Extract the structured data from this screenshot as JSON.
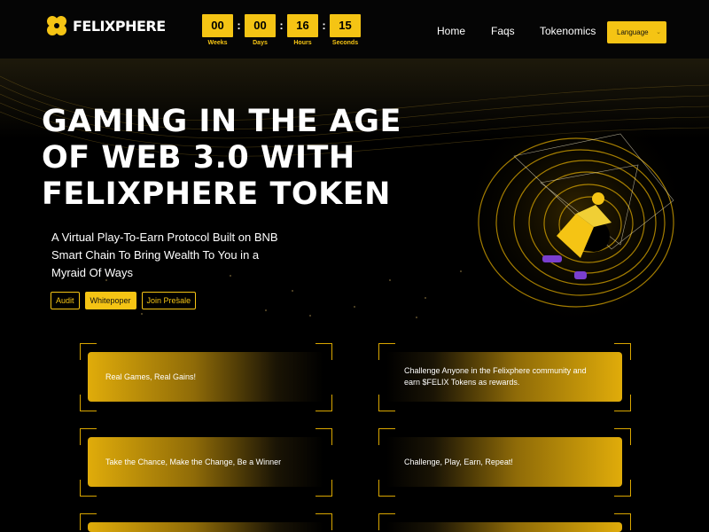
{
  "brand": {
    "name": "FELIXPHERE",
    "logo_icon": "clover-icon",
    "accent": "#f5c414"
  },
  "countdown": [
    {
      "value": "00",
      "label": "Weeks"
    },
    {
      "value": "00",
      "label": "Days"
    },
    {
      "value": "16",
      "label": "Hours"
    },
    {
      "value": "15",
      "label": "Seconds"
    }
  ],
  "nav": {
    "home": "Home",
    "faqs": "Faqs",
    "tokenomics": "Tokenomics",
    "language": "Language"
  },
  "hero": {
    "title": "GAMING IN THE AGE OF WEB 3.0 WITH FELIXPHERE TOKEN",
    "subtitle": "A Virtual Play-To-Earn Protocol Built on BNB Smart Chain To Bring Wealth To You in a Myraid Of Ways",
    "buttons": {
      "audit": "Audit",
      "whitepaper": "Whitepoper",
      "presale": "Join Presale"
    }
  },
  "features": [
    "Real Games, Real Gains!",
    "Challenge Anyone in the Felixphere community and earn $FELIX Tokens as rewards.",
    "Take the Chance, Make the Change, Be a Winner",
    "Challenge, Play, Earn, Repeat!"
  ]
}
